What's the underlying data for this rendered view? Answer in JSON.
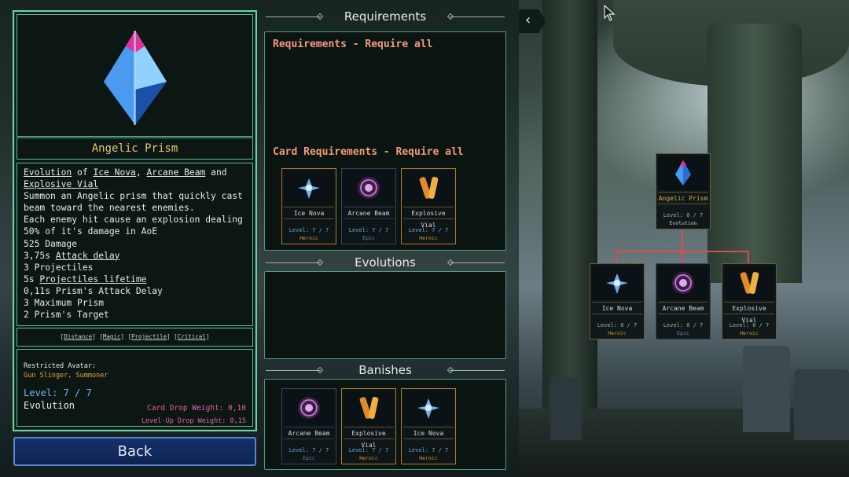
{
  "card": {
    "title": "Angelic Prism",
    "evolution_prefix": "Evolution",
    "of": "of",
    "comma": ",",
    "and": "and",
    "parent_1": "Ice Nova",
    "parent_2": "Arcane Beam",
    "parent_3": "Explosive Vial",
    "description_lines": [
      "Summon an Angelic prism that quickly cast",
      "beam toward the nearest enemies.",
      "Each enemy hit cause an explosion dealing",
      "50% of it's damage in AoE"
    ],
    "stats": [
      {
        "value": "525",
        "label": "Damage",
        "underline": false
      },
      {
        "value": "3,75s",
        "label": "Attack delay",
        "underline": true
      },
      {
        "value": "3",
        "label": "Projectiles",
        "underline": false
      },
      {
        "value": "5s",
        "label": "Projectiles lifetime",
        "underline": true
      },
      {
        "value": "0,11s",
        "label": "Prism's Attack Delay",
        "underline": false
      },
      {
        "value": "3",
        "label": "Maximum Prism",
        "underline": false
      },
      {
        "value": "2",
        "label": "Prism's Target",
        "underline": false
      }
    ],
    "tags": [
      "Distance",
      "Magic",
      "Projectile",
      "Critical"
    ],
    "restricted_avatar_label": "Restricted Avatar:",
    "restricted_avatar_value": "Gun Slinger, Summoner",
    "level": "Level: 7 / 7",
    "type": "Evolution",
    "card_drop_weight": "Card Drop Weight: 0,10",
    "levelup_drop_weight": "Level-Up Drop Weight: 0,15"
  },
  "back_label": "Back",
  "sections": {
    "requirements": "Requirements",
    "evolutions": "Evolutions",
    "banishes": "Banishes",
    "req_all": "Requirements - Require all",
    "card_req_all": "Card Requirements - Require all"
  },
  "card_requirements": [
    {
      "name": "Ice Nova",
      "level": "Level: 7 / 7",
      "rarity": "Heroic",
      "icon": "ice-nova-icon",
      "epic": false
    },
    {
      "name": "Arcane Beam",
      "level": "Level: 7 / 7",
      "rarity": "Epic",
      "icon": "arcane-beam-icon",
      "epic": true
    },
    {
      "name": "Explosive Vial",
      "level": "Level: 7 / 7",
      "rarity": "Heroic",
      "icon": "explosive-vial-icon",
      "epic": false
    }
  ],
  "banishes": [
    {
      "name": "Arcane Beam",
      "level": "Level: 7 / 7",
      "rarity": "Epic",
      "icon": "arcane-beam-icon",
      "epic": true
    },
    {
      "name": "Explosive Vial",
      "level": "Level: 7 / 7",
      "rarity": "Heroic",
      "icon": "explosive-vial-icon",
      "epic": false
    },
    {
      "name": "Ice Nova",
      "level": "Level: 7 / 7",
      "rarity": "Heroic",
      "icon": "ice-nova-icon",
      "epic": false
    }
  ],
  "tree": {
    "root": {
      "name": "Angelic Prism",
      "level": "Level: 0 / 7",
      "rarity": "Evolution"
    },
    "children": [
      {
        "name": "Ice Nova",
        "level": "Level: 0 / 7",
        "rarity": "Heroic"
      },
      {
        "name": "Arcane Beam",
        "level": "Level: 0 / 7",
        "rarity": "Epic"
      },
      {
        "name": "Explosive Vial",
        "level": "Level: 0 / 7",
        "rarity": "Heroic"
      }
    ]
  },
  "colors": {
    "panel_border": "#6fd0a6",
    "title_gold": "#e9c86a",
    "heroic": "#d79a3a",
    "epic": "#7a86c8",
    "weight_pink": "#e35fa6",
    "level_blue": "#6fb6ee",
    "req_title": "#f39a7a",
    "tree_line": "#e04a4a"
  }
}
